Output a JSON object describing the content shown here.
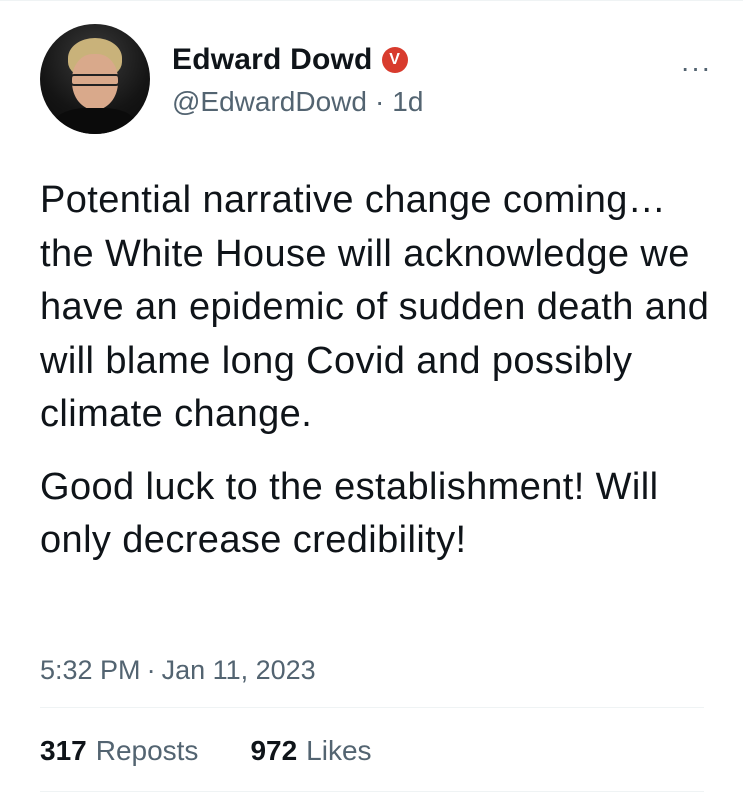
{
  "author": {
    "display_name": "Edward Dowd",
    "verified_badge": "V",
    "handle": "@EdwardDowd",
    "separator": "·",
    "relative_time": "1d",
    "avatar_icon": "profile-photo"
  },
  "menu": {
    "more_label": "···",
    "more_icon": "more-options-icon"
  },
  "tweet": {
    "paragraphs": [
      "Potential narrative change coming…the White House will acknowledge we have an epidemic of sudden death and will blame long Covid and possibly climate change.",
      "Good luck to the establishment! Will only decrease credibility!"
    ]
  },
  "timestamp": {
    "time": "5:32 PM",
    "separator": "·",
    "date": "Jan 11, 2023"
  },
  "stats": {
    "reposts_count": "317",
    "reposts_label": "Reposts",
    "likes_count": "972",
    "likes_label": "Likes"
  },
  "colors": {
    "text_primary": "#0f1419",
    "text_secondary": "#536471",
    "badge": "#d83b2d",
    "divider": "#eff3f4"
  }
}
